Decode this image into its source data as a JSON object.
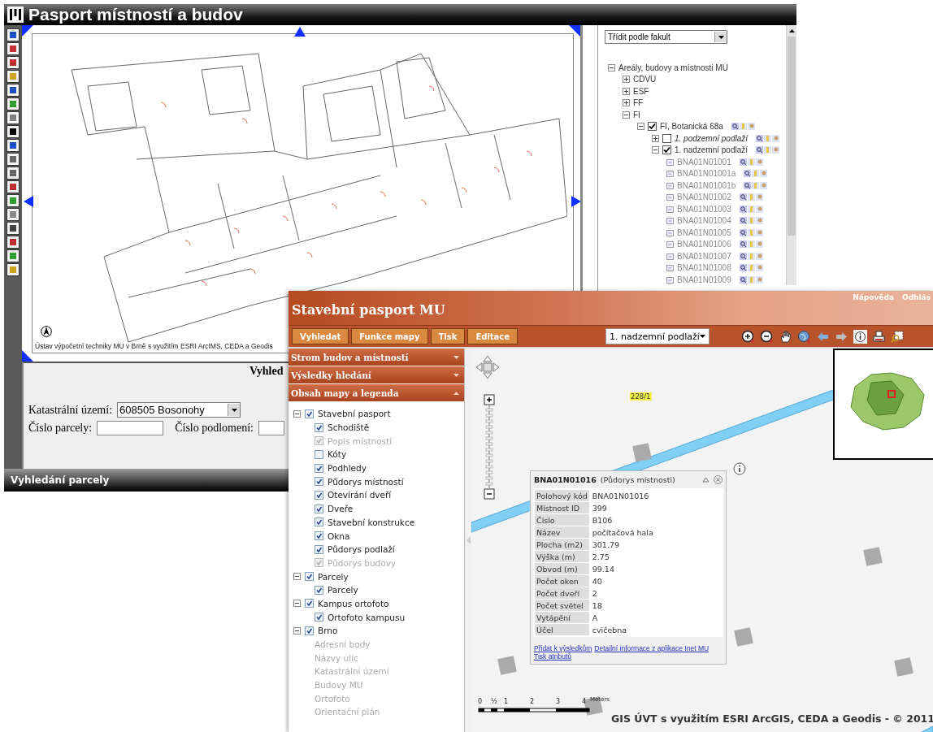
{
  "legacy_window": {
    "title": "Pasport místností a budov",
    "map_credit": "Ústav výpočetní techniky MU v Brně s využitím ESRI ArcIMS, CEDA a Geodis",
    "search_heading": "Vyhled",
    "field_rows": [
      [
        {
          "label": "Katastrální území:",
          "kind": "select",
          "value": "608505 Bosonohy"
        }
      ],
      [
        {
          "label": "Číslo parcely:",
          "kind": "input"
        },
        {
          "label": "Číslo podlomení:",
          "kind": "input"
        }
      ]
    ],
    "footer": "Vyhledání parcely",
    "sort_select": {
      "value": "Třídit podle fakult"
    },
    "tree": [
      {
        "label": "Areály, budovy a místnosti MU",
        "kind": "folder",
        "expanded": true,
        "children": [
          {
            "label": "CDVU",
            "kind": "folder",
            "expanded": false
          },
          {
            "label": "ESF",
            "kind": "folder",
            "expanded": false
          },
          {
            "label": "FF",
            "kind": "folder",
            "expanded": false
          },
          {
            "label": "FI",
            "kind": "folder",
            "expanded": true,
            "children": [
              {
                "label": "FI, Botanická 68a",
                "kind": "layer",
                "expanded": true,
                "checked": true,
                "children": [
                  {
                    "label": "1. podzemní podlaží",
                    "kind": "layer",
                    "expanded": false,
                    "checked": false
                  },
                  {
                    "label": "1. nadzemní podlaží",
                    "kind": "layer",
                    "expanded": true,
                    "checked": true,
                    "children": [
                      {
                        "label": "BNA01N01001",
                        "kind": "room"
                      },
                      {
                        "label": "BNA01N01001a",
                        "kind": "room"
                      },
                      {
                        "label": "BNA01N01001b",
                        "kind": "room"
                      },
                      {
                        "label": "BNA01N01002",
                        "kind": "room"
                      },
                      {
                        "label": "BNA01N01003",
                        "kind": "room"
                      },
                      {
                        "label": "BNA01N01004",
                        "kind": "room"
                      },
                      {
                        "label": "BNA01N01005",
                        "kind": "room"
                      },
                      {
                        "label": "BNA01N01006",
                        "kind": "room"
                      },
                      {
                        "label": "BNA01N01007",
                        "kind": "room"
                      },
                      {
                        "label": "BNA01N01008",
                        "kind": "room"
                      },
                      {
                        "label": "BNA01N01009",
                        "kind": "room"
                      }
                    ]
                  }
                ]
              }
            ]
          }
        ]
      }
    ]
  },
  "main_window": {
    "title": "Stavební pasport MU",
    "header_links": [
      "Nápověda",
      "Odhlás"
    ],
    "menu_buttons": [
      "Vyhledat",
      "Funkce mapy",
      "Tisk",
      "Editace"
    ],
    "floor_select": {
      "value": "1. nadzemní podlaží"
    },
    "panels": [
      {
        "title": "Strom budov a místností",
        "expanded": false
      },
      {
        "title": "Výsledky hledání",
        "expanded": false
      },
      {
        "title": "Obsah mapy a legenda",
        "expanded": true
      }
    ],
    "layers": [
      {
        "label": "Stavební pasport",
        "kind": "group",
        "expanded": true,
        "checked": true,
        "disabled": false,
        "children": [
          {
            "label": "Schodiště",
            "kind": "check",
            "checked": true,
            "disabled": false
          },
          {
            "label": "Popis místností",
            "kind": "check",
            "checked": true,
            "disabled": true
          },
          {
            "label": "Kóty",
            "kind": "check",
            "checked": false,
            "disabled": false
          },
          {
            "label": "Podhledy",
            "kind": "check",
            "checked": true,
            "disabled": false
          },
          {
            "label": "Půdorys místností",
            "kind": "check",
            "checked": true,
            "disabled": false
          },
          {
            "label": "Otevírání dveří",
            "kind": "check",
            "checked": true,
            "disabled": false
          },
          {
            "label": "Dveře",
            "kind": "check",
            "checked": true,
            "disabled": false
          },
          {
            "label": "Stavební konstrukce",
            "kind": "check",
            "checked": true,
            "disabled": false
          },
          {
            "label": "Okna",
            "kind": "check",
            "checked": true,
            "disabled": false
          },
          {
            "label": "Půdorys podlaží",
            "kind": "check",
            "checked": true,
            "disabled": false
          },
          {
            "label": "Půdorys budovy",
            "kind": "check",
            "checked": true,
            "disabled": true
          }
        ]
      },
      {
        "label": "Parcely",
        "kind": "group",
        "expanded": true,
        "checked": true,
        "disabled": false,
        "children": [
          {
            "label": "Parcely",
            "kind": "check",
            "checked": true,
            "disabled": false
          }
        ]
      },
      {
        "label": "Kampus ortofoto",
        "kind": "group",
        "expanded": true,
        "checked": true,
        "disabled": false,
        "children": [
          {
            "label": "Ortofoto kampusu",
            "kind": "check",
            "checked": true,
            "disabled": false
          }
        ]
      },
      {
        "label": "Brno",
        "kind": "group",
        "expanded": true,
        "checked": true,
        "disabled": false,
        "children": [
          {
            "label": "Adresní body",
            "kind": "text"
          },
          {
            "label": "Názvy ulic",
            "kind": "text"
          },
          {
            "label": "Katastrální území",
            "kind": "text"
          },
          {
            "label": "Budovy MU",
            "kind": "text"
          },
          {
            "label": "Ortofoto",
            "kind": "text"
          },
          {
            "label": "Orientační plán",
            "kind": "text"
          }
        ]
      }
    ],
    "map_label": "228/1",
    "popup": {
      "title": "BNA01N01016",
      "subtitle": "(Půdorys místnosti)",
      "rows": [
        {
          "name": "Polohový kód",
          "value": "BNA01N01016"
        },
        {
          "name": "Místnost ID",
          "value": "399"
        },
        {
          "name": "Číslo",
          "value": "B106"
        },
        {
          "name": "Název",
          "value": "počítačová hala"
        },
        {
          "name": "Plocha (m2)",
          "value": "301.79"
        },
        {
          "name": "Výška (m)",
          "value": "2.75"
        },
        {
          "name": "Obvod (m)",
          "value": "99.14"
        },
        {
          "name": "Počet oken",
          "value": "40"
        },
        {
          "name": "Počet dveří",
          "value": "2"
        },
        {
          "name": "Počet světel",
          "value": "18"
        },
        {
          "name": "Vytápění",
          "value": "A"
        },
        {
          "name": "Účel",
          "value": "cvičebna"
        }
      ],
      "links": [
        "Přidat k výsledkům",
        "Detailní informace z aplikace Inet MU",
        "Tisk atributů"
      ]
    },
    "scale_labels": [
      "0",
      "½",
      "1",
      "2",
      "3",
      "4"
    ],
    "scale_unit": "Meters",
    "credit": "GIS ÚVT s využitím ESRI ArcGIS, CEDA a Geodis - © 2011"
  }
}
